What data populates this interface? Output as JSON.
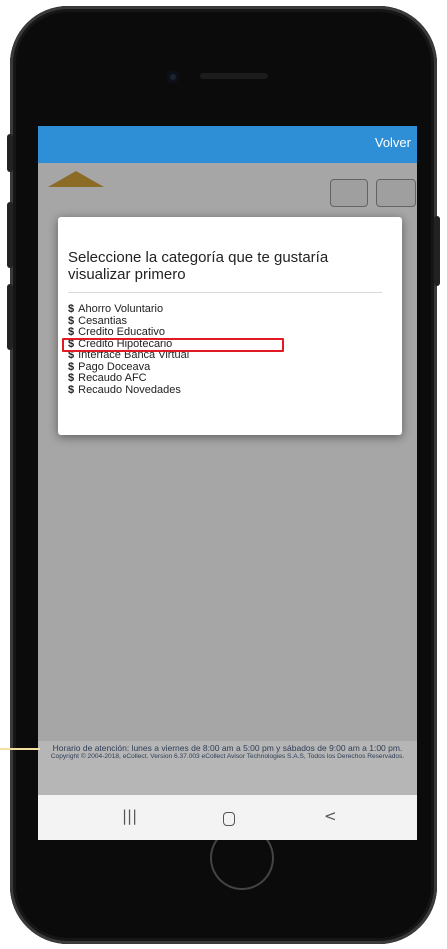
{
  "app": {
    "back_label": "Volver"
  },
  "modal": {
    "title": "Seleccione la categoría que te gustaría visualizar primero",
    "items": [
      {
        "label": "Ahorro Voluntario",
        "icon": "dollar-icon"
      },
      {
        "label": "Cesantias",
        "icon": "dollar-icon"
      },
      {
        "label": "Credito Educativo",
        "icon": "dollar-icon"
      },
      {
        "label": "Credito Hipotecario",
        "icon": "dollar-icon",
        "highlighted": true
      },
      {
        "label": "Interface Banca Virtual",
        "icon": "dollar-icon"
      },
      {
        "label": "Pago Doceava",
        "icon": "dollar-icon"
      },
      {
        "label": "Recaudo AFC",
        "icon": "dollar-icon"
      },
      {
        "label": "Recaudo Novedades",
        "icon": "dollar-icon"
      }
    ],
    "bullet_symbol": "$",
    "highlight_color": "#e01b24"
  },
  "footer": {
    "hours": "Horario de atención: lunes a viernes de 8:00 am a 5:00 pm y sábados de 9:00 am a 1:00 pm.",
    "copyright": "Copyright © 2004-2018, eCollect. Version 6.37.003 eCollect Avisor Technologies S.A.S, Todos los Derechos Reservados."
  },
  "navbar": {
    "recent_icon": "|||",
    "back_icon": "<"
  },
  "colors": {
    "appbar": "#2e8fd6",
    "footer_bg": "#b6b6b6",
    "footer_text": "#2f3d55"
  }
}
